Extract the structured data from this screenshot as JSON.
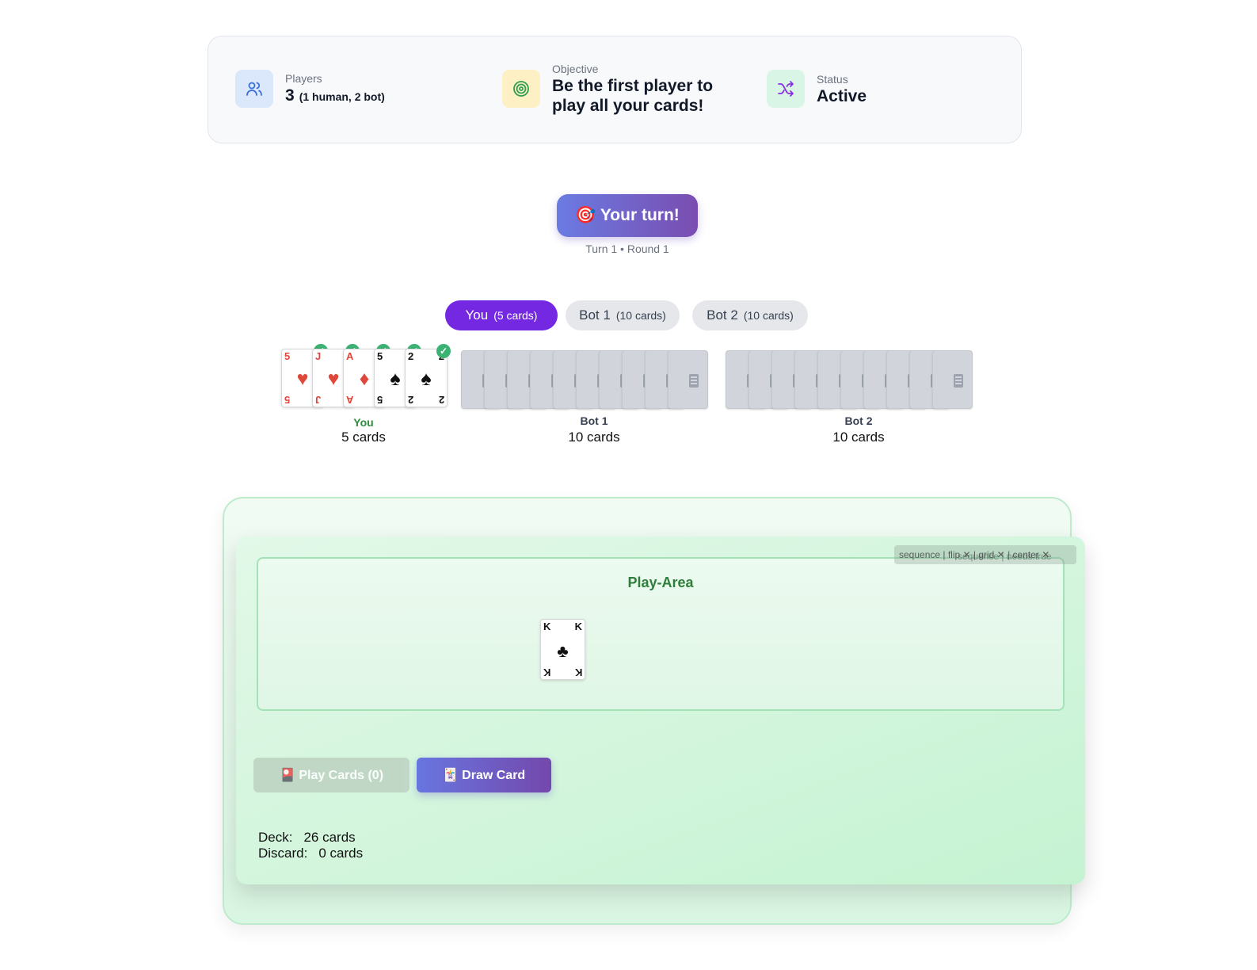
{
  "info": {
    "players_label": "Players",
    "players_value": "3",
    "players_detail": "(1 human, 2 bot)",
    "objective_label": "Objective",
    "objective_line1": "Be the first player to",
    "objective_line2": "play all your cards!",
    "status_label": "Status",
    "status_value": "Active"
  },
  "turn": {
    "banner": "🎯 Your turn!",
    "info": "Turn 1 • Round 1"
  },
  "tabs": [
    {
      "name": "You",
      "count": "(5 cards)"
    },
    {
      "name": "Bot 1",
      "count": "(10 cards)"
    },
    {
      "name": "Bot 2",
      "count": "(10 cards)"
    }
  ],
  "hands": {
    "you": {
      "name": "You",
      "count": "5 cards",
      "cards": [
        {
          "rank": "5",
          "suit": "♥",
          "color": "red"
        },
        {
          "rank": "J",
          "suit": "♥",
          "color": "red"
        },
        {
          "rank": "A",
          "suit": "♦",
          "color": "red"
        },
        {
          "rank": "5",
          "suit": "♠",
          "color": "black"
        },
        {
          "rank": "2",
          "suit": "♠",
          "color": "black"
        }
      ]
    },
    "bot1": {
      "name": "Bot 1",
      "count": "10 cards"
    },
    "bot2": {
      "name": "Bot 2",
      "count": "10 cards"
    }
  },
  "play_area": {
    "title": "Play-Area",
    "debug_tag": "sequence | flip ✕ | grid ✕ | center ✕",
    "debug_ghost": "sequence | needs:true",
    "card": {
      "rank": "K",
      "suit": "♣",
      "color": "black"
    }
  },
  "actions": {
    "play": "🎴 Play Cards (0)",
    "draw": "🃏 Draw Card"
  },
  "piles": {
    "deck_label": "Deck:",
    "deck_value": "26 cards",
    "discard_label": "Discard:",
    "discard_value": "0 cards"
  },
  "colors": {
    "accent": "#7428e2",
    "card_red": "#e0473b",
    "selected_check": "#3bb273",
    "zone_green": "#c5f3d2"
  }
}
